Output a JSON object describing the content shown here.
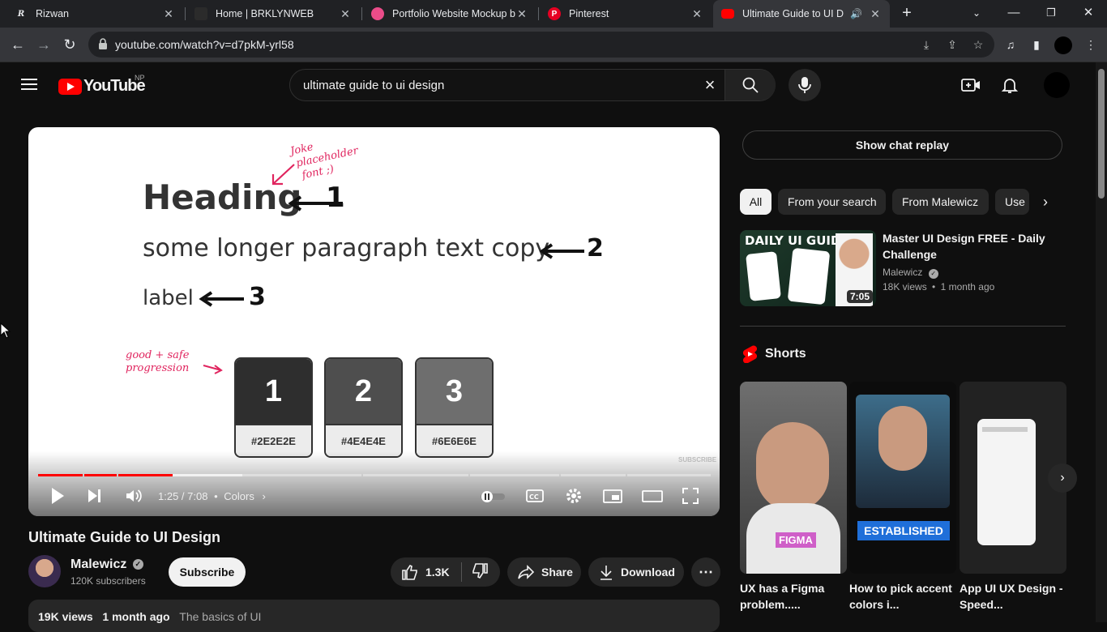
{
  "browser": {
    "tabs": [
      {
        "title": "Rizwan",
        "icon": "r-logo-icon"
      },
      {
        "title": "Home | BRKLYNWEB",
        "icon": "site-icon"
      },
      {
        "title": "Portfolio Website Mockup b",
        "icon": "dribbble-icon"
      },
      {
        "title": "Pinterest",
        "icon": "pinterest-icon"
      },
      {
        "title": "Ultimate Guide to UI De",
        "icon": "youtube-icon"
      }
    ],
    "url": "youtube.com/watch?v=d7pkM-yrl58"
  },
  "header": {
    "logo_text": "YouTube",
    "country": "NP",
    "search_value": "ultimate guide to ui design"
  },
  "player": {
    "slide": {
      "heading": "Heading",
      "paragraph": "some longer paragraph text copy",
      "label": "label",
      "num1": "1",
      "num2": "2",
      "num3": "3",
      "note_top": "Joke placeholder font ;)",
      "note_top_lines": [
        "Joke",
        "placeholder",
        "font ;)"
      ],
      "note_left_lines": [
        "good + safe",
        "progression"
      ],
      "swatches": [
        {
          "num": "1",
          "hex": "#2E2E2E",
          "color": "#2e2e2e"
        },
        {
          "num": "2",
          "hex": "#4E4E4E",
          "color": "#4e4e4e"
        },
        {
          "num": "3",
          "hex": "#6E6E6E",
          "color": "#6e6e6e"
        }
      ],
      "watermark": "SUBSCRIBE"
    },
    "time": "1:25 / 7:08",
    "chapter": "Colors",
    "progress_fraction": 0.2
  },
  "video": {
    "title": "Ultimate Guide to UI Design",
    "channel": "Malewicz",
    "subscribers": "120K subscribers",
    "subscribe_label": "Subscribe",
    "likes": "1.3K",
    "share_label": "Share",
    "download_label": "Download",
    "views": "19K views",
    "date": "1 month ago",
    "desc_preview": "The basics of UI"
  },
  "sidebar": {
    "chat_replay": "Show chat replay",
    "chips": [
      "All",
      "From your search",
      "From Malewicz",
      "Use"
    ],
    "recommended": {
      "title": "Master UI Design FREE - Daily Challenge",
      "channel": "Malewicz",
      "views": "18K views",
      "date": "1 month ago",
      "duration": "7:05",
      "thumb_text": "DAILY UI GUIDE"
    },
    "shorts_heading": "Shorts",
    "shorts": [
      {
        "title": "UX has a Figma problem.....",
        "badge": "FIGMA"
      },
      {
        "title": "How to pick accent colors i...",
        "badge": "ESTABLISHED"
      },
      {
        "title": "App UI UX Design - Speed...",
        "badge": ""
      }
    ]
  }
}
